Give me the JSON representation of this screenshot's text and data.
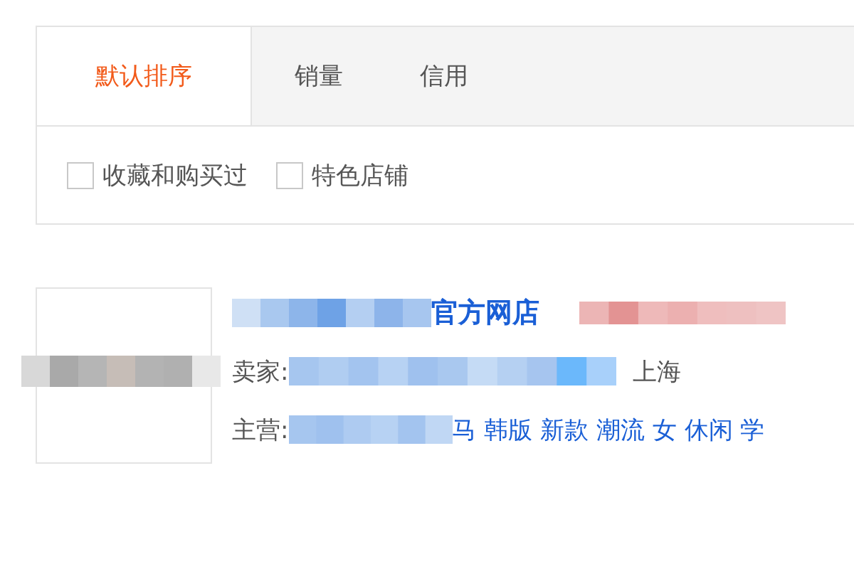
{
  "tabs": [
    {
      "label": "默认排序",
      "selected": true
    },
    {
      "label": "销量",
      "selected": false
    },
    {
      "label": "信用",
      "selected": false
    }
  ],
  "filters": [
    {
      "label": "收藏和购买过",
      "checked": false
    },
    {
      "label": "特色店铺",
      "checked": false
    }
  ],
  "shop": {
    "title": "官方网店",
    "seller_label": "卖家:",
    "location": "上海",
    "main_label": "主营:",
    "main_items": "马 韩版 新款 潮流 女 休闲 学"
  }
}
